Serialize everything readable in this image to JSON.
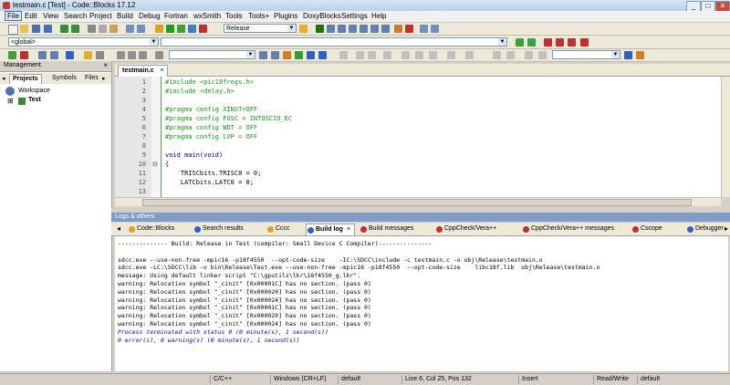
{
  "window": {
    "title": "testmain.c [Test] - Code::Blocks 17.12",
    "min": "_",
    "max": "□",
    "close": "✕"
  },
  "menu": [
    "File",
    "Edit",
    "View",
    "Search",
    "Project",
    "Build",
    "Debug",
    "Fortran",
    "wxSmith",
    "Tools",
    "Tools+",
    "Plugins",
    "DoxyBlocks",
    "Settings",
    "Help"
  ],
  "toolbar": {
    "build_target": "Release",
    "scope": "<global>"
  },
  "management": {
    "title": "Management",
    "close": "×",
    "tabs": [
      "Projects",
      "Symbols",
      "Files"
    ],
    "tree": {
      "root": "Workspace",
      "project": "Test",
      "expander": "⊞"
    }
  },
  "editor": {
    "tab": "testmain.c",
    "tab_close": "×",
    "lines": [
      {
        "n": "1",
        "text": "#include <pic18fregs.h>",
        "cls": "pp"
      },
      {
        "n": "2",
        "text": "#include <delay.h>",
        "cls": "pp"
      },
      {
        "n": "3",
        "text": "",
        "cls": ""
      },
      {
        "n": "4",
        "text": "#pragma config XINST=OFF",
        "cls": "pp"
      },
      {
        "n": "5",
        "text": "#pragma config FOSC = INTOSCIO_EC",
        "cls": "pp"
      },
      {
        "n": "6",
        "text": "#pragma config WDT = OFF",
        "cls": "pp"
      },
      {
        "n": "7",
        "text": "#pragma config LVP = OFF",
        "cls": "pp"
      },
      {
        "n": "8",
        "text": "",
        "cls": ""
      },
      {
        "n": "9",
        "text": "void main(void)",
        "cls": "kw"
      },
      {
        "n": "10",
        "text": "{",
        "cls": ""
      },
      {
        "n": "11",
        "text": "    TRISCbits.TRISC0 = 0;",
        "cls": ""
      },
      {
        "n": "12",
        "text": "    LATCbits.LATC0 = 0;",
        "cls": ""
      },
      {
        "n": "13",
        "text": "",
        "cls": ""
      }
    ]
  },
  "logs": {
    "title": "Logs & others",
    "tabs": [
      "Code::Blocks",
      "Search results",
      "Cccc",
      "Build log",
      "Build messages",
      "CppCheck/Vera++",
      "CppCheck/Vera++ messages",
      "Cscope",
      "Debugger"
    ],
    "lines": [
      {
        "text": "-------------- Build: Release in Test (compiler: Small Device C Compiler)---------------",
        "blue": false
      },
      {
        "text": "",
        "blue": false
      },
      {
        "text": "sdcc.exe --use-non-free -mpic16 -p18f4550  --opt-code-size    -IC:\\SDCC\\include -c testmain.c -o obj\\Release\\testmain.o",
        "blue": false
      },
      {
        "text": "sdcc.exe -LC:\\SDCC\\lib -o bin\\Release\\Test.exe --use-non-free -mpic16 -p18f4550  --opt-code-size    libc18f.lib  obj\\Release\\testmain.o",
        "blue": false
      },
      {
        "text": "message: Using default linker script \"C:\\gputils\\lkr\\18f4550_g.lkr\".",
        "blue": false
      },
      {
        "text": "warning: Relocation symbol \"_cinit\" [0x00001C] has no section. (pass 0)",
        "blue": false
      },
      {
        "text": "warning: Relocation symbol \"_cinit\" [0x000020] has no section. (pass 0)",
        "blue": false
      },
      {
        "text": "warning: Relocation symbol \"_cinit\" [0x000024] has no section. (pass 0)",
        "blue": false
      },
      {
        "text": "warning: Relocation symbol \"_cinit\" [0x00001C] has no section. (pass 0)",
        "blue": false
      },
      {
        "text": "warning: Relocation symbol \"_cinit\" [0x000020] has no section. (pass 0)",
        "blue": false
      },
      {
        "text": "warning: Relocation symbol \"_cinit\" [0x000024] has no section. (pass 0)",
        "blue": false
      },
      {
        "text": "Process terminated with status 0 (0 minute(s), 1 second(s))",
        "blue": true
      },
      {
        "text": "0 error(s), 0 warning(s) (0 minute(s), 1 second(s))",
        "blue": true
      }
    ]
  },
  "status": {
    "language": "C/C++",
    "eol": "Windows (CR+LF)",
    "encoding": "default",
    "position": "Line 6, Col 25, Pos 132",
    "mode": "Insert",
    "access": "Read/Write",
    "profile": "default"
  },
  "colors": {
    "preprocessor": "#1a9a1a",
    "keyword": "#00008b",
    "logs_header": "#7f9cc8",
    "log_summary": "#0000cc"
  }
}
